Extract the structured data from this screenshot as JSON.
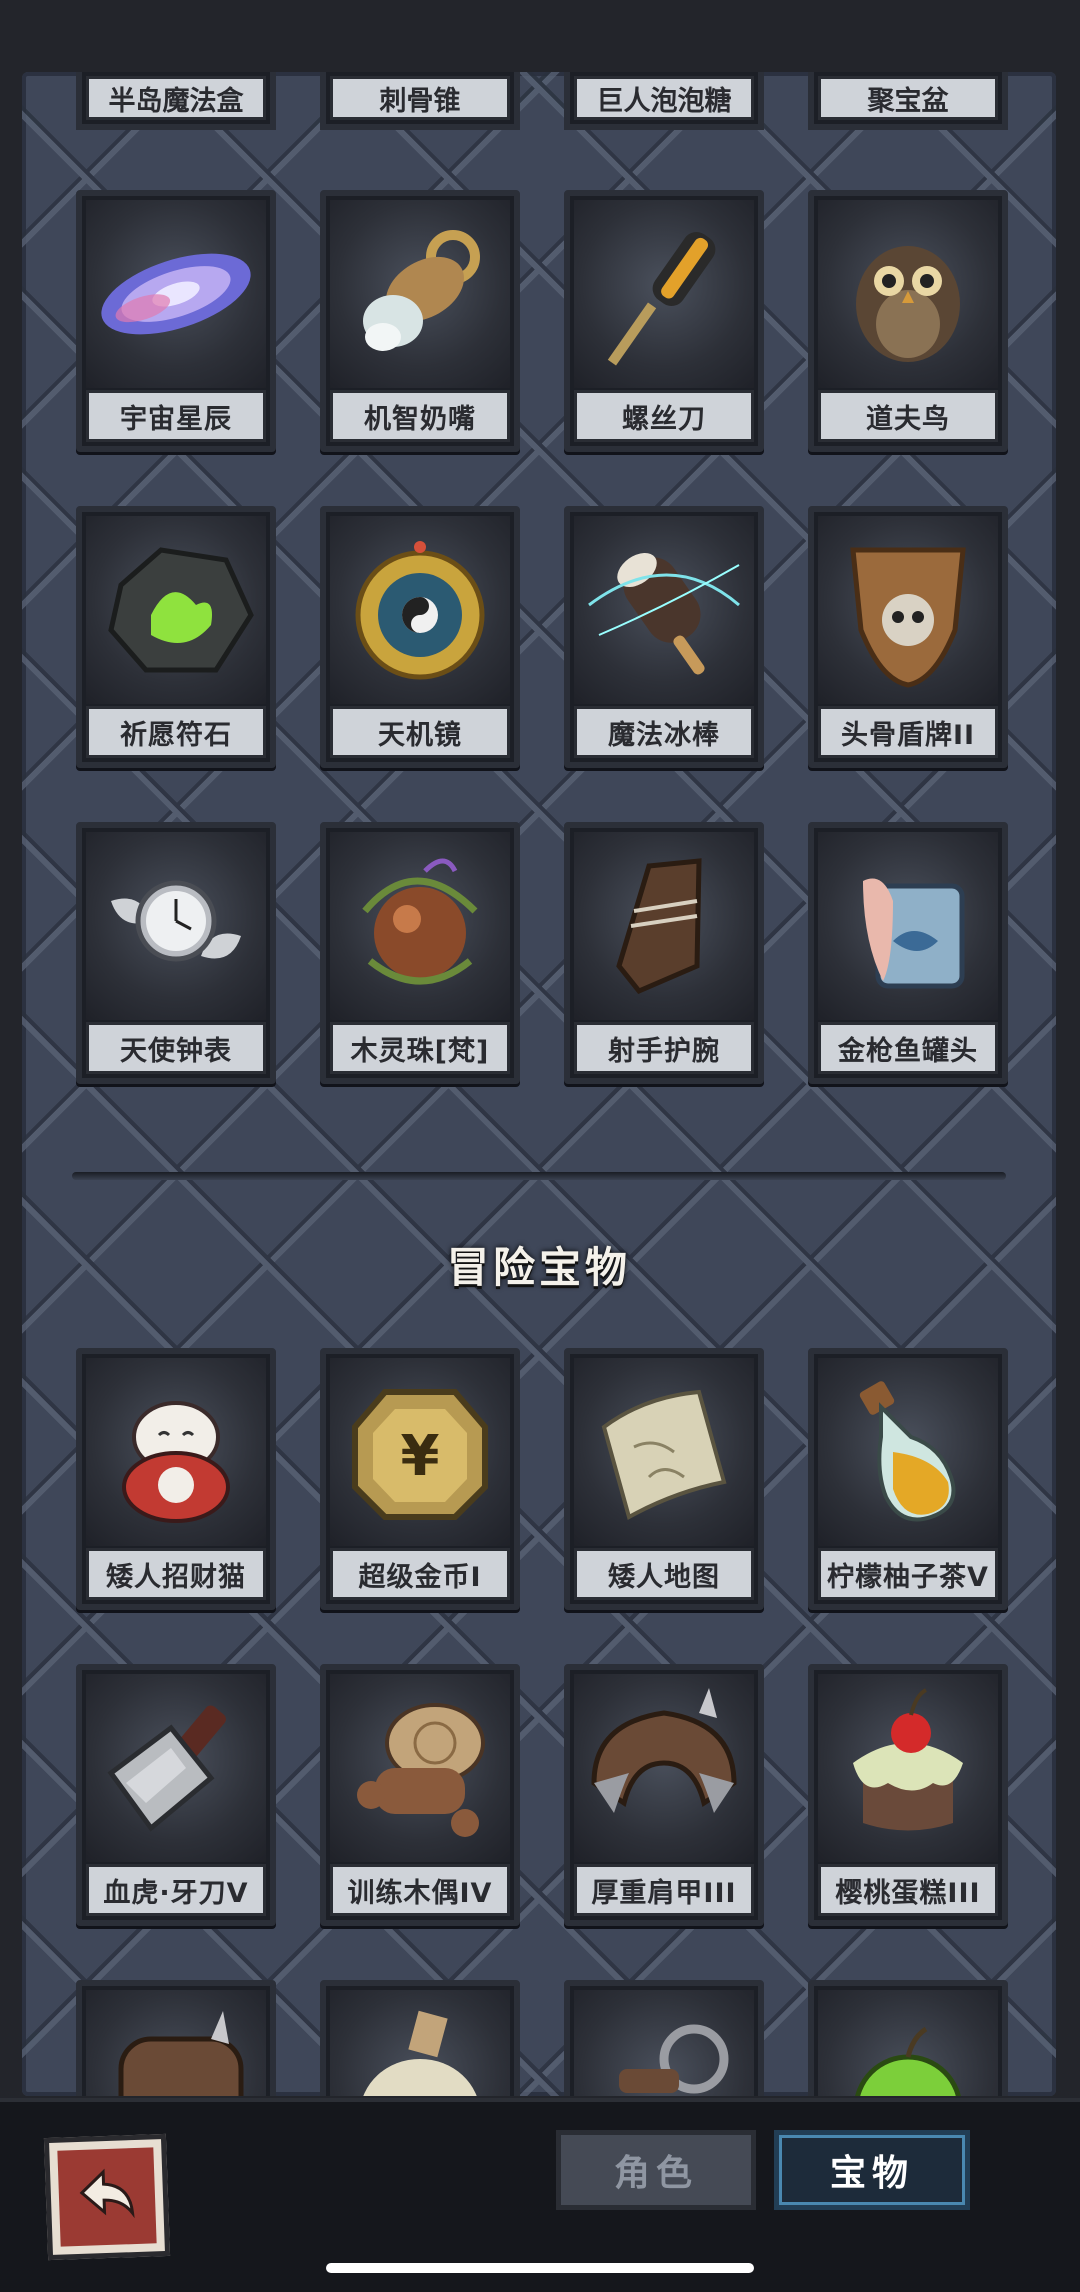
{
  "top_row_labels": [
    "半岛魔法盒",
    "刺骨锥",
    "巨人泡泡糖",
    "聚宝盆"
  ],
  "rows": [
    {
      "items": [
        {
          "name": "宇宙星辰",
          "icon": "galaxy-icon"
        },
        {
          "name": "机智奶嘴",
          "icon": "pacifier-icon"
        },
        {
          "name": "螺丝刀",
          "icon": "screwdriver-icon"
        },
        {
          "name": "道夫鸟",
          "icon": "owl-icon"
        }
      ]
    },
    {
      "items": [
        {
          "name": "祈愿符石",
          "icon": "rune-stone-icon"
        },
        {
          "name": "天机镜",
          "icon": "bagua-mirror-icon"
        },
        {
          "name": "魔法冰棒",
          "icon": "ice-pop-icon"
        },
        {
          "name": "头骨盾牌II",
          "icon": "skull-shield-icon"
        }
      ]
    },
    {
      "items": [
        {
          "name": "天使钟表",
          "icon": "winged-clock-icon"
        },
        {
          "name": "木灵珠[梵]",
          "icon": "wood-orb-icon"
        },
        {
          "name": "射手护腕",
          "icon": "bracer-icon"
        },
        {
          "name": "金枪鱼罐头",
          "icon": "tuna-can-icon"
        }
      ]
    }
  ],
  "section_title": "冒险宝物",
  "adventure_rows": [
    {
      "items": [
        {
          "name": "矮人招财猫",
          "icon": "lucky-cat-icon"
        },
        {
          "name": "超级金币I",
          "icon": "gold-coin-icon"
        },
        {
          "name": "矮人地图",
          "icon": "map-scroll-icon"
        },
        {
          "name": "柠檬柚子茶V",
          "icon": "potion-bottle-icon"
        }
      ]
    },
    {
      "items": [
        {
          "name": "血虎·牙刀V",
          "icon": "cleaver-icon"
        },
        {
          "name": "训练木偶IV",
          "icon": "wooden-dummy-icon"
        },
        {
          "name": "厚重肩甲III",
          "icon": "shoulder-armor-icon"
        },
        {
          "name": "樱桃蛋糕III",
          "icon": "cherry-cake-icon"
        }
      ]
    }
  ],
  "partial_row_icons": [
    "spiked-barrel-icon",
    "sack-icon",
    "key-ring-icon",
    "green-apple-icon"
  ],
  "tabs": {
    "roles": "角色",
    "treasure": "宝物",
    "active": "treasure"
  }
}
